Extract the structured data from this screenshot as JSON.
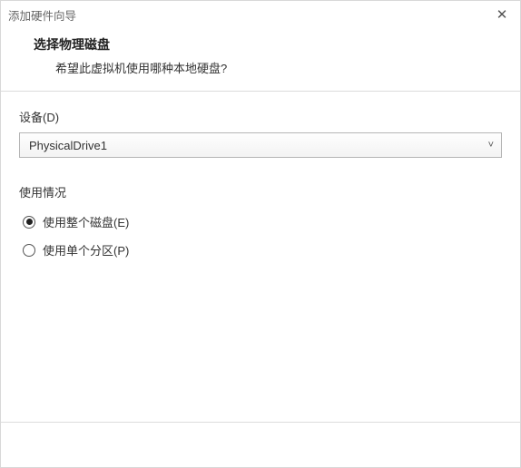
{
  "window": {
    "title": "添加硬件向导"
  },
  "header": {
    "title": "选择物理磁盘",
    "subtitle": "希望此虚拟机使用哪种本地硬盘?"
  },
  "device": {
    "label": "设备(D)",
    "selected": "PhysicalDrive1"
  },
  "usage": {
    "label": "使用情况",
    "options": [
      {
        "label": "使用整个磁盘(E)",
        "checked": true
      },
      {
        "label": "使用单个分区(P)",
        "checked": false
      }
    ]
  }
}
